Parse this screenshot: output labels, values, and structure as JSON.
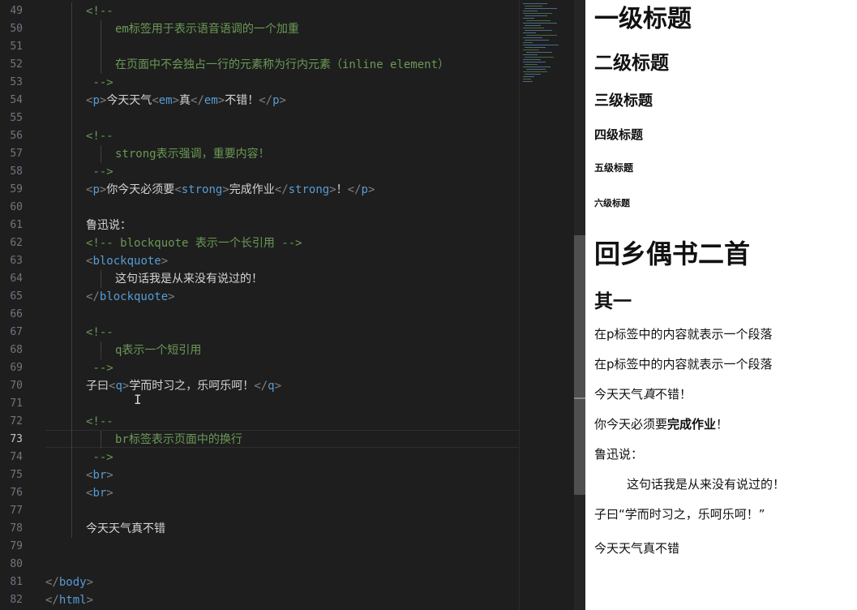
{
  "editor": {
    "lines": [
      {
        "no": "49",
        "indent": 1,
        "tokens": [
          {
            "t": "<!--",
            "c": "cm"
          }
        ]
      },
      {
        "no": "50",
        "indent": 2,
        "tokens": [
          {
            "t": "em标签用于表示语音语调的一个加重",
            "c": "cm"
          }
        ]
      },
      {
        "no": "51",
        "indent": 0,
        "tokens": []
      },
      {
        "no": "52",
        "indent": 2,
        "tokens": [
          {
            "t": "在页面中不会独占一行的元素称为行内元素（inline element）",
            "c": "cm"
          }
        ]
      },
      {
        "no": "53",
        "indent": 1,
        "tokens": [
          {
            "t": " -->",
            "c": "cm"
          }
        ]
      },
      {
        "no": "54",
        "indent": 1,
        "tokens": [
          {
            "t": "<",
            "c": "br"
          },
          {
            "t": "p",
            "c": "tg"
          },
          {
            "t": ">",
            "c": "br"
          },
          {
            "t": "今天天气",
            "c": "tx"
          },
          {
            "t": "<",
            "c": "br"
          },
          {
            "t": "em",
            "c": "tg"
          },
          {
            "t": ">",
            "c": "br"
          },
          {
            "t": "真",
            "c": "tx"
          },
          {
            "t": "</",
            "c": "br"
          },
          {
            "t": "em",
            "c": "tg"
          },
          {
            "t": ">",
            "c": "br"
          },
          {
            "t": "不错！",
            "c": "tx"
          },
          {
            "t": "</",
            "c": "br"
          },
          {
            "t": "p",
            "c": "tg"
          },
          {
            "t": ">",
            "c": "br"
          }
        ]
      },
      {
        "no": "55",
        "indent": 0,
        "tokens": []
      },
      {
        "no": "56",
        "indent": 1,
        "tokens": [
          {
            "t": "<!--",
            "c": "cm"
          }
        ]
      },
      {
        "no": "57",
        "indent": 2,
        "tokens": [
          {
            "t": "strong表示强调，重要内容！",
            "c": "cm"
          }
        ]
      },
      {
        "no": "58",
        "indent": 1,
        "tokens": [
          {
            "t": " -->",
            "c": "cm"
          }
        ]
      },
      {
        "no": "59",
        "indent": 1,
        "tokens": [
          {
            "t": "<",
            "c": "br"
          },
          {
            "t": "p",
            "c": "tg"
          },
          {
            "t": ">",
            "c": "br"
          },
          {
            "t": "你今天必须要",
            "c": "tx"
          },
          {
            "t": "<",
            "c": "br"
          },
          {
            "t": "strong",
            "c": "tg"
          },
          {
            "t": ">",
            "c": "br"
          },
          {
            "t": "完成作业",
            "c": "tx"
          },
          {
            "t": "</",
            "c": "br"
          },
          {
            "t": "strong",
            "c": "tg"
          },
          {
            "t": ">",
            "c": "br"
          },
          {
            "t": "！",
            "c": "tx"
          },
          {
            "t": "</",
            "c": "br"
          },
          {
            "t": "p",
            "c": "tg"
          },
          {
            "t": ">",
            "c": "br"
          }
        ]
      },
      {
        "no": "60",
        "indent": 0,
        "tokens": []
      },
      {
        "no": "61",
        "indent": 1,
        "tokens": [
          {
            "t": "鲁迅说：",
            "c": "tx"
          }
        ]
      },
      {
        "no": "62",
        "indent": 1,
        "tokens": [
          {
            "t": "<!-- blockquote 表示一个长引用 -->",
            "c": "cm"
          }
        ]
      },
      {
        "no": "63",
        "indent": 1,
        "tokens": [
          {
            "t": "<",
            "c": "br"
          },
          {
            "t": "blockquote",
            "c": "tg"
          },
          {
            "t": ">",
            "c": "br"
          }
        ]
      },
      {
        "no": "64",
        "indent": 2,
        "tokens": [
          {
            "t": "这句话我是从来没有说过的！",
            "c": "tx"
          }
        ]
      },
      {
        "no": "65",
        "indent": 1,
        "tokens": [
          {
            "t": "</",
            "c": "br"
          },
          {
            "t": "blockquote",
            "c": "tg"
          },
          {
            "t": ">",
            "c": "br"
          }
        ]
      },
      {
        "no": "66",
        "indent": 0,
        "tokens": []
      },
      {
        "no": "67",
        "indent": 1,
        "tokens": [
          {
            "t": "<!--",
            "c": "cm"
          }
        ]
      },
      {
        "no": "68",
        "indent": 2,
        "tokens": [
          {
            "t": "q表示一个短引用",
            "c": "cm"
          }
        ]
      },
      {
        "no": "69",
        "indent": 1,
        "tokens": [
          {
            "t": " -->",
            "c": "cm"
          }
        ]
      },
      {
        "no": "70",
        "indent": 1,
        "tokens": [
          {
            "t": "子曰",
            "c": "tx"
          },
          {
            "t": "<",
            "c": "br"
          },
          {
            "t": "q",
            "c": "tg"
          },
          {
            "t": ">",
            "c": "br"
          },
          {
            "t": "学而时习之，乐呵乐呵！",
            "c": "tx"
          },
          {
            "t": "</",
            "c": "br"
          },
          {
            "t": "q",
            "c": "tg"
          },
          {
            "t": ">",
            "c": "br"
          }
        ]
      },
      {
        "no": "71",
        "indent": 0,
        "tokens": []
      },
      {
        "no": "72",
        "indent": 1,
        "tokens": [
          {
            "t": "<!--",
            "c": "cm"
          }
        ]
      },
      {
        "no": "73",
        "indent": 2,
        "tokens": [
          {
            "t": "br标签表示页面中的换行",
            "c": "cm"
          }
        ]
      },
      {
        "no": "74",
        "indent": 1,
        "tokens": [
          {
            "t": " -->",
            "c": "cm"
          }
        ]
      },
      {
        "no": "75",
        "indent": 1,
        "tokens": [
          {
            "t": "<",
            "c": "br"
          },
          {
            "t": "br",
            "c": "tg"
          },
          {
            "t": ">",
            "c": "br"
          }
        ]
      },
      {
        "no": "76",
        "indent": 1,
        "tokens": [
          {
            "t": "<",
            "c": "br"
          },
          {
            "t": "br",
            "c": "tg"
          },
          {
            "t": ">",
            "c": "br"
          }
        ]
      },
      {
        "no": "77",
        "indent": 0,
        "tokens": []
      },
      {
        "no": "78",
        "indent": 1,
        "tokens": [
          {
            "t": "今天天气真不错",
            "c": "tx"
          }
        ]
      },
      {
        "no": "79",
        "indent": 0,
        "tokens": []
      },
      {
        "no": "80",
        "indent": 0,
        "tokens": []
      },
      {
        "no": "81",
        "indent": 0,
        "tokens": [
          {
            "t": "</",
            "c": "br"
          },
          {
            "t": "body",
            "c": "tg"
          },
          {
            "t": ">",
            "c": "br"
          }
        ]
      },
      {
        "no": "82",
        "indent": 0,
        "tokens": [
          {
            "t": "</",
            "c": "br"
          },
          {
            "t": "html",
            "c": "tg"
          },
          {
            "t": ">",
            "c": "br"
          }
        ]
      }
    ],
    "active_line": "73"
  },
  "preview": {
    "h1": "一级标题",
    "h2": "二级标题",
    "h3": "三级标题",
    "h4": "四级标题",
    "h5": "五级标题",
    "h6": "六级标题",
    "poem_title": "回乡偶书二首",
    "poem_sub": "其一",
    "para1": "在p标签中的内容就表示一个段落",
    "para2": "在p标签中的内容就表示一个段落",
    "weather_a": "今天天气",
    "weather_em": "真",
    "weather_b": "不错！",
    "must_a": "你今天必须要",
    "must_strong": "完成作业",
    "must_b": "！",
    "luxun": "鲁迅说：",
    "blockquote": "这句话我是从来没有说过的！",
    "confucius": "子曰“学而时习之，乐呵乐呵！”",
    "final": "今天天气真不错"
  }
}
